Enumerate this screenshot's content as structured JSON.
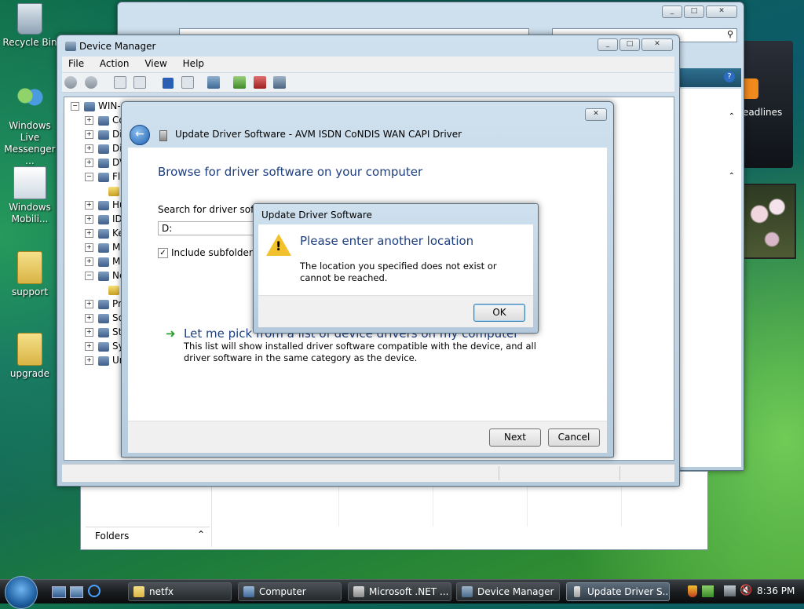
{
  "desktop": {
    "icons": [
      {
        "label": "Recycle Bin"
      },
      {
        "label": "Windows Live Messenger ..."
      },
      {
        "label": "Windows Mobili..."
      },
      {
        "label": "support"
      },
      {
        "label": "upgrade"
      }
    ],
    "gadget_label": "eadlines"
  },
  "explorer": {
    "folders_label": "Folders"
  },
  "device_manager": {
    "title": "Device Manager",
    "menu": [
      "File",
      "Action",
      "View",
      "Help"
    ],
    "tree_root": "WIN-...",
    "tree_items": [
      "Co",
      "Di",
      "Di",
      "DV",
      "Fl",
      "",
      "Hu",
      "ID",
      "Ke",
      "M",
      "M",
      "Ne",
      "",
      "Pr",
      "So",
      "St",
      "Sy",
      "Ur"
    ]
  },
  "wizard": {
    "title": "Update Driver Software - AVM ISDN CoNDIS WAN CAPI Driver",
    "heading": "Browse for driver software on your computer",
    "search_label": "Search for driver softwa",
    "path_value": "D:",
    "include_subfolders": "Include subfolders",
    "pick_link": "Let me pick from a list of device drivers on my computer",
    "pick_desc": "This list will show installed driver software compatible with the device, and all driver software in the same category as the device.",
    "next": "Next",
    "cancel": "Cancel"
  },
  "alert": {
    "title": "Update Driver Software",
    "heading": "Please enter another location",
    "message": "The location you specified does not exist or cannot be reached.",
    "ok": "OK"
  },
  "taskbar": {
    "tasks": [
      "netfx",
      "Computer",
      "Microsoft .NET ...",
      "Device Manager",
      "Update Driver S..."
    ],
    "clock": "8:36 PM"
  },
  "colors": {
    "heading_blue": "#1e3f80",
    "link_green": "#2aa02a"
  }
}
